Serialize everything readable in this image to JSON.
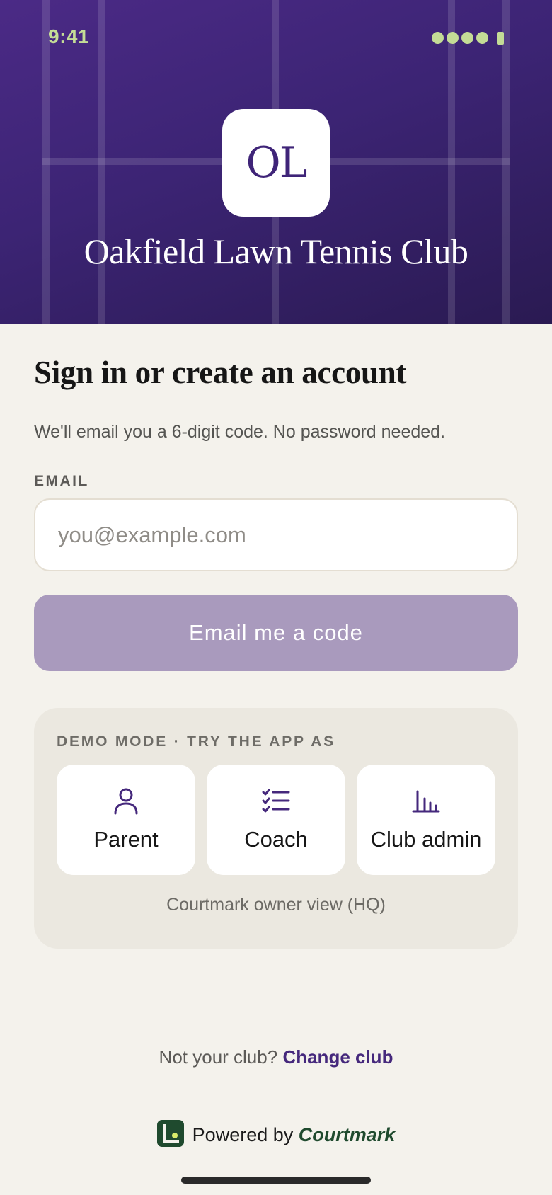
{
  "status_bar": {
    "time": "9:41"
  },
  "club": {
    "initials": "OL",
    "name": "Oakfield Lawn Tennis Club"
  },
  "signin": {
    "title": "Sign in or create an account",
    "subtitle": "We'll email you a 6-digit code. No password needed.",
    "email_label": "EMAIL",
    "email_value": "",
    "email_placeholder": "you@example.com",
    "submit_label": "Email me a code"
  },
  "demo": {
    "label": "DEMO MODE · TRY THE APP AS",
    "roles": [
      {
        "label": "Parent",
        "icon": "person-icon"
      },
      {
        "label": "Coach",
        "icon": "checklist-icon"
      },
      {
        "label": "Club admin",
        "icon": "bar-chart-icon"
      }
    ],
    "owner_view_label": "Courtmark owner view (HQ)"
  },
  "footer": {
    "not_your_club": "Not your club?",
    "change_club": "Change club",
    "powered_by": "Powered by",
    "brand": "Courtmark"
  },
  "colors": {
    "brand_purple": "#3f2478",
    "accent_lime": "#c4dc96",
    "button_disabled": "#a99abd",
    "courtmark_green": "#1f4a2e",
    "background": "#f4f2ec"
  }
}
